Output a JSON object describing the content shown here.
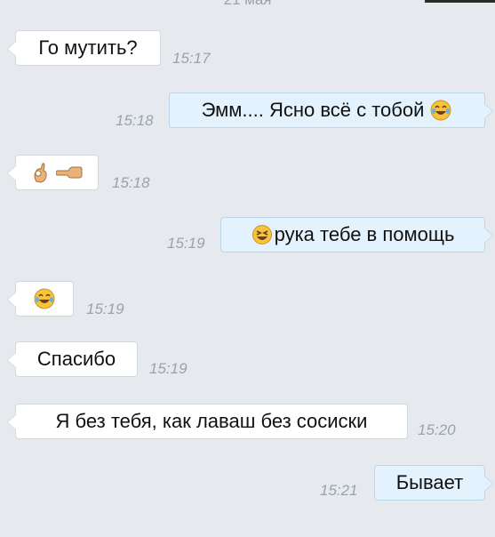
{
  "date_header_top": "21 мая",
  "date_header_bottom": "",
  "messages": [
    {
      "dir": "in",
      "text": "Го мутить?",
      "time": "15:17"
    },
    {
      "dir": "out",
      "text": "Эмм.... Ясно всё с тобой",
      "emoji_after": "joy-emoji",
      "time": "15:18"
    },
    {
      "dir": "in",
      "text": "",
      "emoji": [
        "ok-hand-emoji",
        "pointing-left-emoji"
      ],
      "time": "15:18"
    },
    {
      "dir": "out",
      "text": "рука тебе в помощь",
      "emoji_before": "laughing-emoji",
      "time": "15:19"
    },
    {
      "dir": "in",
      "text": "",
      "emoji": [
        "joy-emoji"
      ],
      "time": "15:19"
    },
    {
      "dir": "in",
      "text": "Спасибо",
      "time": "15:19"
    },
    {
      "dir": "in",
      "text": "Я без тебя, как лаваш без сосиски",
      "time": "15:20"
    },
    {
      "dir": "out",
      "text": "Бывает",
      "time": "15:21"
    }
  ],
  "colors": {
    "background": "#e6e9ed",
    "incoming": "#ffffff",
    "outgoing": "#e3f2fc",
    "time": "#9aa3ad"
  }
}
